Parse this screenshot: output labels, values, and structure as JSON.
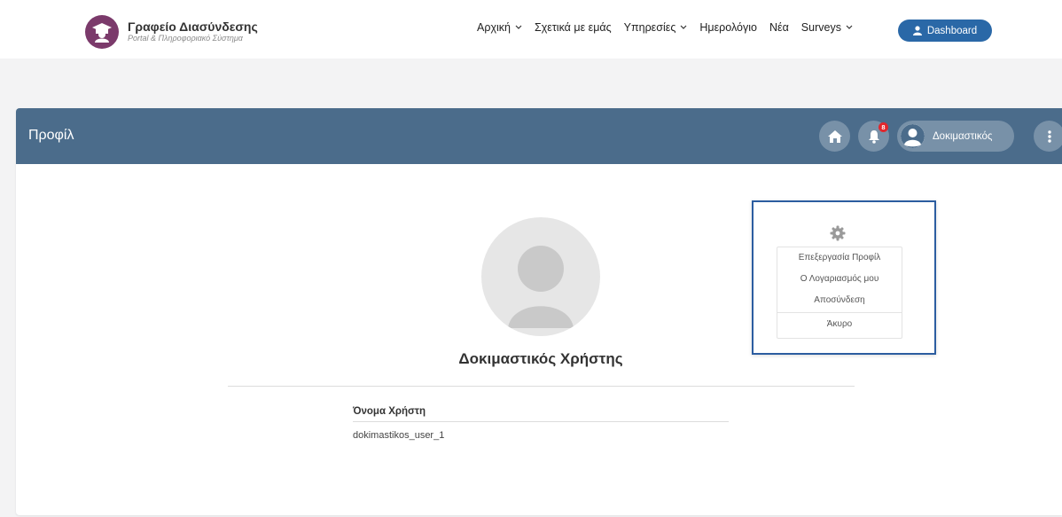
{
  "brand": {
    "title": "Γραφείο Διασύνδεσης",
    "subtitle": "Portal & Πληροφοριακό Σύστημα",
    "logo_color": "#7b3a6b"
  },
  "nav": {
    "items": [
      {
        "label": "Αρχική",
        "has_dropdown": true
      },
      {
        "label": "Σχετικά με εμάς",
        "has_dropdown": false
      },
      {
        "label": "Υπηρεσίες",
        "has_dropdown": true
      },
      {
        "label": "Ημερολόγιο",
        "has_dropdown": false
      },
      {
        "label": "Νέα",
        "has_dropdown": false
      },
      {
        "label": "Surveys",
        "has_dropdown": true
      }
    ],
    "dashboard_label": "Dashboard",
    "accent": "#2a68a7"
  },
  "header": {
    "title": "Προφίλ",
    "notification_count": "8",
    "user_label": "Δοκιμαστικός",
    "color": "#4b6c8b"
  },
  "profile": {
    "name": "Δοκιμαστικός Χρήστης",
    "field_label": "Όνομα Χρήστη",
    "field_value": "dokimastikos_user_1"
  },
  "dropdown": {
    "items": [
      "Επεξεργασία Προφίλ",
      "Ο Λογαριασμός μου",
      "Αποσύνδεση"
    ],
    "cancel": "Άκυρο",
    "highlight_color": "#2c5da0"
  }
}
